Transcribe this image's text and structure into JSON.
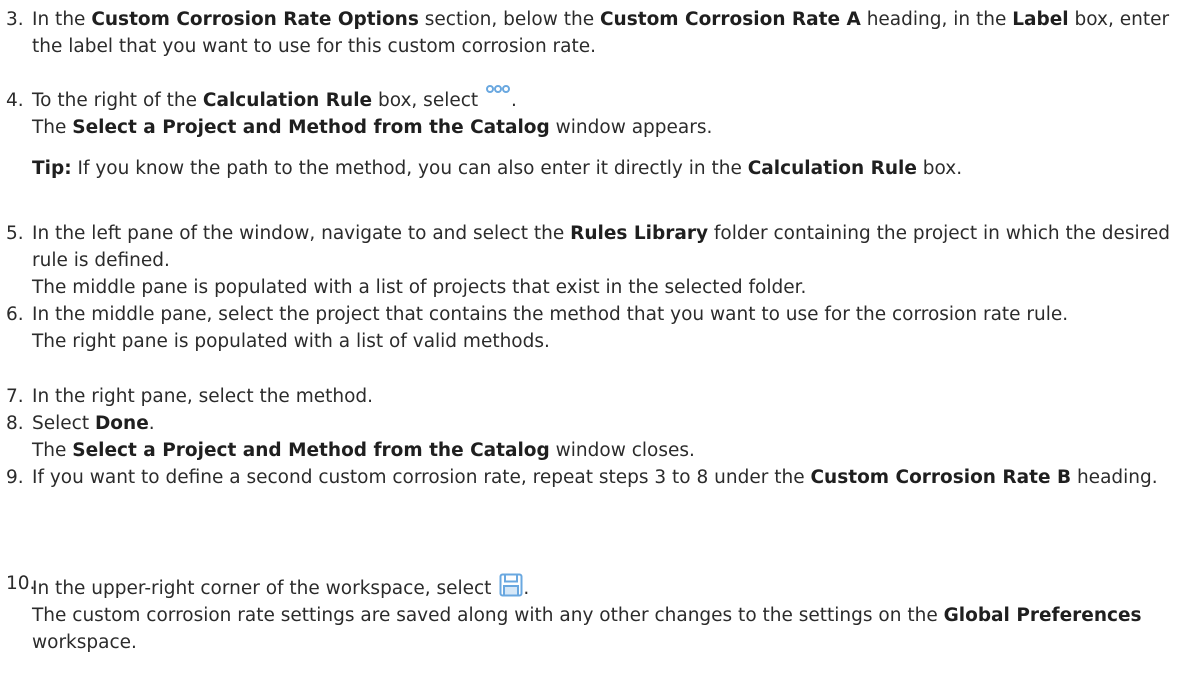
{
  "steps": [
    {
      "num": "3.",
      "segments": [
        {
          "t": "In the "
        },
        {
          "b": "Custom Corrosion Rate Options"
        },
        {
          "t": " section, below the "
        },
        {
          "b": "Custom Corrosion Rate A"
        },
        {
          "t": " heading, in the "
        },
        {
          "b": "Label"
        },
        {
          "t": " box, enter the label that you want to use for this custom corrosion rate."
        }
      ]
    },
    {
      "num": "4.",
      "line1": [
        {
          "t": "To the right of the "
        },
        {
          "b": "Calculation Rule"
        },
        {
          "t": " box, select "
        }
      ],
      "line1_end": ".",
      "line2": [
        {
          "t": "The "
        },
        {
          "b": "Select a Project and Method from the Catalog"
        },
        {
          "t": " window appears."
        }
      ],
      "tip": [
        {
          "b": "Tip:"
        },
        {
          "t": " If you know the path to the method, you can also enter it directly in the "
        },
        {
          "b": "Calculation Rule"
        },
        {
          "t": " box."
        }
      ]
    },
    {
      "num": "5.",
      "line1": [
        {
          "t": "In the left pane of the window, navigate to and select the "
        },
        {
          "b": "Rules Library"
        },
        {
          "t": " folder containing the project in which the desired rule is defined."
        }
      ],
      "line2": [
        {
          "t": "The middle pane is populated with a list of projects that exist in the selected folder."
        }
      ]
    },
    {
      "num": "6.",
      "line1": [
        {
          "t": "In the middle pane, select the project that contains the method that you want to use for the corrosion rate rule."
        }
      ],
      "line2": [
        {
          "t": "The right pane is populated with a list of valid methods."
        }
      ]
    },
    {
      "num": "7.",
      "line1": [
        {
          "t": "In the right pane, select the method."
        }
      ]
    },
    {
      "num": "8.",
      "line1": [
        {
          "t": "Select "
        },
        {
          "b": "Done"
        },
        {
          "t": "."
        }
      ],
      "line2": [
        {
          "t": "The "
        },
        {
          "b": "Select a Project and Method from the Catalog"
        },
        {
          "t": " window closes."
        }
      ]
    },
    {
      "num": "9.",
      "line1": [
        {
          "t": "If you want to define a second custom corrosion rate, repeat steps 3 to 8 under the "
        },
        {
          "b": "Custom Corrosion Rate B"
        },
        {
          "t": " heading."
        }
      ]
    },
    {
      "num": "10.",
      "line1": [
        {
          "t": "In the upper-right corner of the workspace, select "
        }
      ],
      "line1_end": ".",
      "line2": [
        {
          "t": "The custom corrosion rate settings are saved along with any other changes to the settings on the "
        },
        {
          "b": "Global Preferences"
        },
        {
          "t": " workspace."
        }
      ]
    }
  ],
  "colors": {
    "text": "#2b2b2b",
    "icon_blue": "#6aa8e0",
    "icon_blue_dark": "#3d7fc4"
  },
  "icons": {
    "step4_inline": "more-options-icon",
    "step10_inline": "save-icon"
  }
}
